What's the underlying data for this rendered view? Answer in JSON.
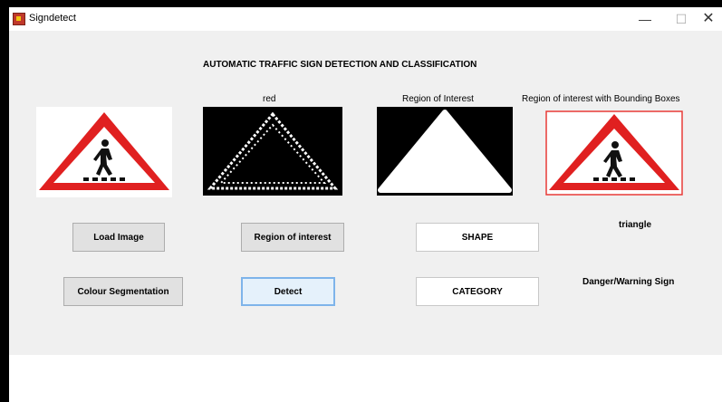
{
  "window": {
    "title": "Signdetect",
    "minimize_glyph": "—",
    "maximize_glyph": "☐",
    "close_glyph": "✕"
  },
  "heading": "AUTOMATIC TRAFFIC SIGN DETECTION AND CLASSIFICATION",
  "panels": {
    "original_caption": "",
    "colour_caption": "red",
    "roi_caption": "Region of Interest",
    "bbox_caption": "Region of interest with Bounding Boxes"
  },
  "buttons": {
    "load_image": "Load Image",
    "region_of_interest": "Region of interest",
    "colour_segmentation": "Colour Segmentation",
    "detect": "Detect"
  },
  "fields": {
    "shape": "SHAPE",
    "category": "CATEGORY"
  },
  "results": {
    "shape": "triangle",
    "category": "Danger/Warning Sign"
  },
  "colors": {
    "sign_red": "#e02020",
    "sign_white": "#ffffff",
    "panel_bg": "#f0f0f0",
    "bbox": "#e53935"
  }
}
